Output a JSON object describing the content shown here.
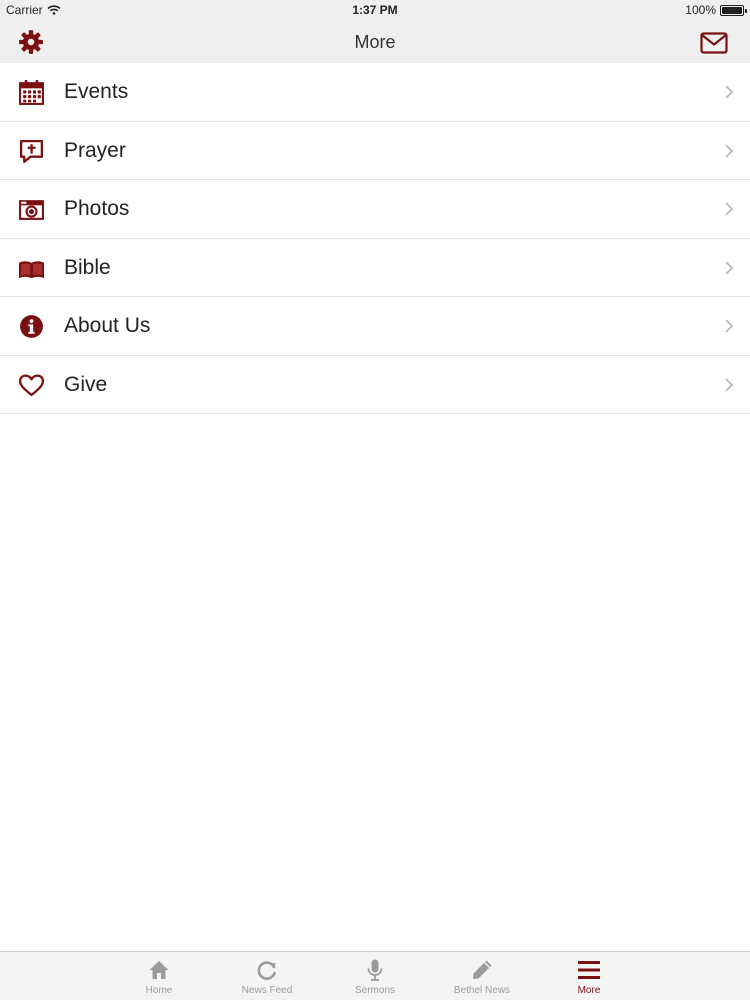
{
  "status_bar": {
    "carrier": "Carrier",
    "time": "1:37 PM",
    "battery": "100%",
    "battery_level": 1.0
  },
  "nav": {
    "title": "More",
    "left_icon": "gear-icon",
    "right_icon": "mail-icon"
  },
  "menu": [
    {
      "label": "Events",
      "icon": "calendar-icon"
    },
    {
      "label": "Prayer",
      "icon": "prayer-bubble-icon"
    },
    {
      "label": "Photos",
      "icon": "camera-icon"
    },
    {
      "label": "Bible",
      "icon": "book-icon"
    },
    {
      "label": "About Us",
      "icon": "info-icon"
    },
    {
      "label": "Give",
      "icon": "heart-icon"
    }
  ],
  "tabs": [
    {
      "label": "Home",
      "icon": "home-icon"
    },
    {
      "label": "News Feed",
      "icon": "refresh-icon"
    },
    {
      "label": "Sermons",
      "icon": "microphone-icon"
    },
    {
      "label": "Bethel News",
      "icon": "pencil-icon"
    },
    {
      "label": "More",
      "icon": "menu-icon",
      "active": true
    }
  ],
  "colors": {
    "accent": "#7a1010",
    "bar_bg": "#efefef",
    "tab_inactive": "#9b9b9b",
    "separator": "#e3e3e3"
  }
}
